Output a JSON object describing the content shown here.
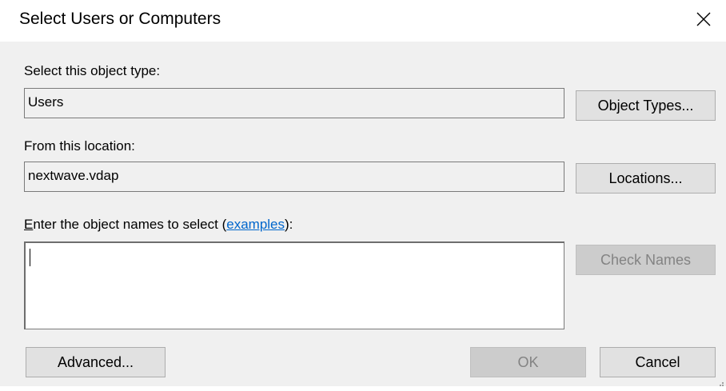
{
  "dialog": {
    "title": "Select Users or Computers",
    "close_icon": "close-icon"
  },
  "object_type": {
    "label": "Select this object type:",
    "value": "Users",
    "button_label": "Object Types..."
  },
  "location": {
    "label": "From this location:",
    "value": "nextwave.vdap",
    "button_label": "Locations..."
  },
  "names": {
    "label_accesskey": "E",
    "label_rest": "nter the object names to select (",
    "link_label": "examples",
    "label_end": "):",
    "value": "",
    "check_names_label": "Check Names",
    "check_names_enabled": false
  },
  "footer": {
    "advanced_label": "Advanced...",
    "ok_label": "OK",
    "ok_enabled": false,
    "cancel_label": "Cancel"
  },
  "colors": {
    "dialog_bg": "#f0f0f0",
    "link": "#0066cc",
    "button_bg": "#e1e1e1",
    "disabled_button_bg": "#cccccc",
    "disabled_text": "#838383"
  }
}
